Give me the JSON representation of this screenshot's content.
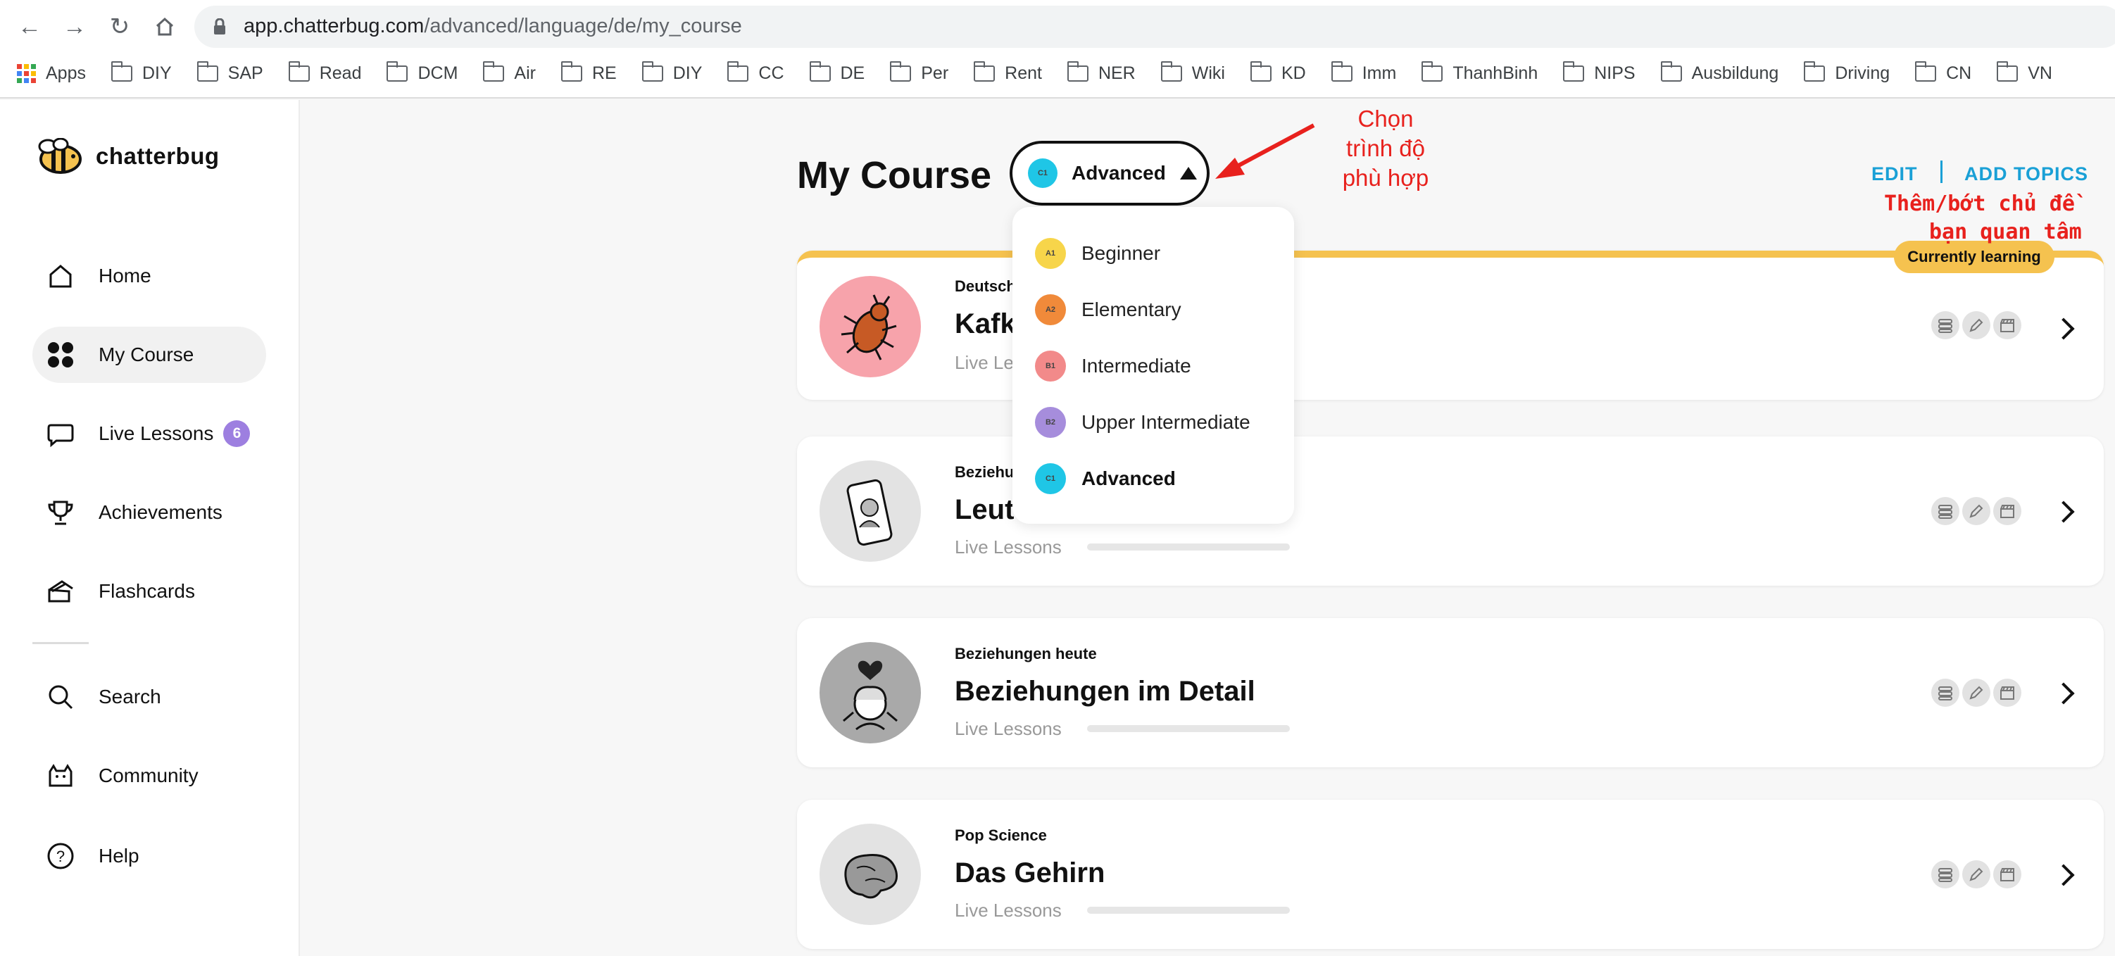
{
  "browser": {
    "url_host": "app.chatterbug.com",
    "url_path": "/advanced/language/de/my_course",
    "bookmarks": [
      "Apps",
      "DIY",
      "SAP",
      "Read",
      "DCM",
      "Air",
      "RE",
      "DIY",
      "CC",
      "DE",
      "Per",
      "Rent",
      "NER",
      "Wiki",
      "KD",
      "Imm",
      "ThanhBinh",
      "NIPS",
      "Ausbildung",
      "Driving",
      "CN",
      "VN"
    ]
  },
  "sidebar": {
    "brand": "chatterbug",
    "items": [
      {
        "label": "Home",
        "icon": "home-icon"
      },
      {
        "label": "My Course",
        "icon": "grid-icon"
      },
      {
        "label": "Live Lessons",
        "icon": "chat-bubble-icon",
        "badge": "6"
      },
      {
        "label": "Achievements",
        "icon": "trophy-icon"
      },
      {
        "label": "Flashcards",
        "icon": "flashcards-icon"
      },
      {
        "label": "Search",
        "icon": "search-icon"
      },
      {
        "label": "Community",
        "icon": "community-icon"
      },
      {
        "label": "Help",
        "icon": "help-icon"
      }
    ]
  },
  "main": {
    "title": "My Course",
    "level": {
      "code": "C1",
      "label": "Advanced",
      "color": "#1fc6e6"
    },
    "edit_label": "EDIT",
    "add_topics_label": "ADD TOPICS",
    "currently_learning": "Currently learning",
    "cards": [
      {
        "category": "Deutsch",
        "title": "Kafk",
        "sub": "Live Le"
      },
      {
        "category": "Beziehu",
        "title": "Leute",
        "sub": "Live Lessons",
        "progress": 0.0
      },
      {
        "category": "Beziehungen heute",
        "title": "Beziehungen im Detail",
        "sub": "Live Lessons",
        "progress": 0.0
      },
      {
        "category": "Pop Science",
        "title": "Das Gehirn",
        "sub": "Live Lessons",
        "progress": 0.0
      }
    ]
  },
  "dropdown": {
    "options": [
      {
        "code": "A1",
        "label": "Beginner",
        "color": "#f7d54a"
      },
      {
        "code": "A2",
        "label": "Elementary",
        "color": "#f08a3a"
      },
      {
        "code": "B1",
        "label": "Intermediate",
        "color": "#f28a8a"
      },
      {
        "code": "B2",
        "label": "Upper Intermediate",
        "color": "#a68ddc"
      },
      {
        "code": "C1",
        "label": "Advanced",
        "color": "#1fc6e6"
      }
    ]
  },
  "annotations": {
    "level_note": [
      "Chọn",
      "trình độ",
      "phù hợp"
    ],
    "topics_note": [
      "Thêm/bớt chủ đề",
      "bạn quan tâm"
    ]
  }
}
